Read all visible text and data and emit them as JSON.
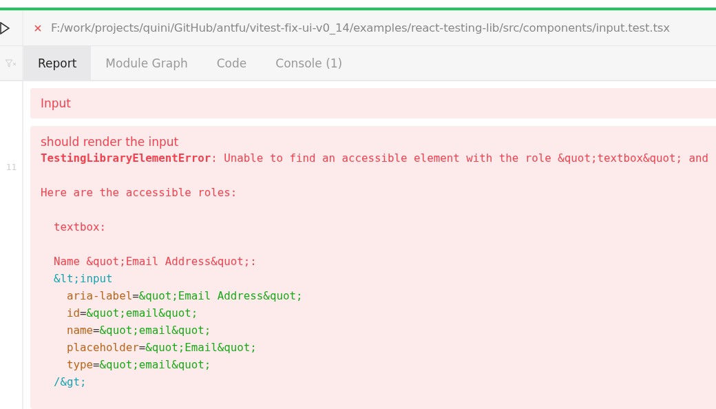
{
  "header": {
    "failed": true,
    "path": "F:/work/projects/quini/GitHub/antfu/vitest-fix-ui-v0_14/examples/react-testing-lib/src/components/input.test.tsx"
  },
  "tabs": [
    {
      "label": "Report",
      "selected": true
    },
    {
      "label": "Module Graph",
      "selected": false
    },
    {
      "label": "Code",
      "selected": false
    },
    {
      "label": "Console (1)",
      "selected": false
    }
  ],
  "sidebar": {
    "duration": "11"
  },
  "report": {
    "suite": "Input",
    "test": {
      "name": "should render the input",
      "error_lines": [
        {
          "kind": "code",
          "segments": [
            {
              "kind": "error",
              "text": "**TestingLibraryElementError**: Unable to find an accessible element with the role &quot;textbox&quot; and"
            }
          ]
        },
        {
          "kind": "blank"
        },
        {
          "kind": "code",
          "segments": [
            {
              "kind": "error",
              "text": "Here are the accessible roles:"
            }
          ]
        },
        {
          "kind": "blank"
        },
        {
          "kind": "code",
          "segments": [
            {
              "kind": "error",
              "text": "  textbox:"
            }
          ]
        },
        {
          "kind": "blank"
        },
        {
          "kind": "code",
          "segments": [
            {
              "kind": "error",
              "text": "  Name &quot;Email Address&quot;:"
            }
          ]
        },
        {
          "kind": "code",
          "segments": [
            {
              "kind": "tag",
              "text": "  &lt;input"
            }
          ]
        },
        {
          "kind": "code",
          "segments": [
            {
              "kind": "attr",
              "text": "    aria-label"
            },
            {
              "kind": "eq",
              "text": "="
            },
            {
              "kind": "string",
              "text": "&quot;Email Address&quot;"
            }
          ]
        },
        {
          "kind": "code",
          "segments": [
            {
              "kind": "attr",
              "text": "    id"
            },
            {
              "kind": "eq",
              "text": "="
            },
            {
              "kind": "string",
              "text": "&quot;email&quot;"
            }
          ]
        },
        {
          "kind": "code",
          "segments": [
            {
              "kind": "attr",
              "text": "    name"
            },
            {
              "kind": "eq",
              "text": "="
            },
            {
              "kind": "string",
              "text": "&quot;email&quot;"
            }
          ]
        },
        {
          "kind": "code",
          "segments": [
            {
              "kind": "attr",
              "text": "    placeholder"
            },
            {
              "kind": "eq",
              "text": "="
            },
            {
              "kind": "string",
              "text": "&quot;Email&quot;"
            }
          ]
        },
        {
          "kind": "code",
          "segments": [
            {
              "kind": "attr",
              "text": "    type"
            },
            {
              "kind": "eq",
              "text": "="
            },
            {
              "kind": "string",
              "text": "&quot;email&quot;"
            }
          ]
        },
        {
          "kind": "code",
          "segments": [
            {
              "kind": "tag",
              "text": "  /&gt;"
            }
          ]
        }
      ]
    }
  }
}
